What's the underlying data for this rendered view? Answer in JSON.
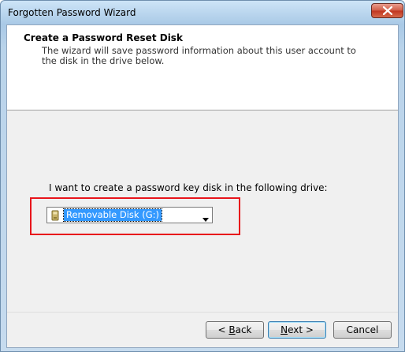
{
  "window": {
    "title": "Forgotten Password Wizard"
  },
  "header": {
    "title": "Create a Password Reset Disk",
    "description": "The wizard will save password information about this user account to the disk in the drive below."
  },
  "main": {
    "prompt": "I want to create a password key disk in the following drive:",
    "drive_select": {
      "selected": "Removable Disk (G:)",
      "icon": "removable-disk-icon"
    }
  },
  "buttons": {
    "back_prefix": "< ",
    "back_underline": "B",
    "back_rest": "ack",
    "next_underline": "N",
    "next_rest": "ext >",
    "cancel": "Cancel"
  },
  "colors": {
    "highlight": "#e8141b",
    "selection": "#3399ff"
  }
}
